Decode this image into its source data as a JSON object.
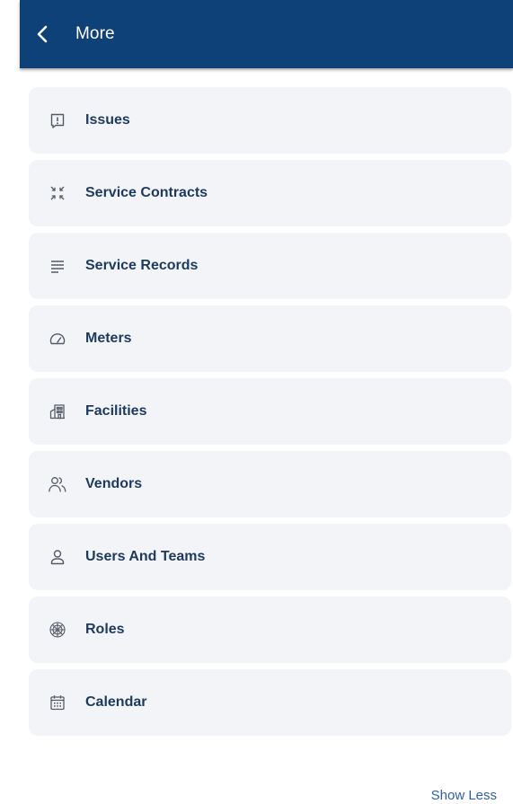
{
  "header": {
    "title": "More",
    "back_icon": "chevron-left-icon",
    "background_color": "#0d4178"
  },
  "menu": {
    "items": [
      {
        "label": "Issues",
        "icon": "issue-icon"
      },
      {
        "label": "Service Contracts",
        "icon": "collapse-arrows-icon"
      },
      {
        "label": "Service Records",
        "icon": "lines-icon"
      },
      {
        "label": "Meters",
        "icon": "gauge-icon"
      },
      {
        "label": "Facilities",
        "icon": "building-icon"
      },
      {
        "label": "Vendors",
        "icon": "users-group-icon"
      },
      {
        "label": "Users And Teams",
        "icon": "user-icon"
      },
      {
        "label": "Roles",
        "icon": "roles-icon"
      },
      {
        "label": "Calendar",
        "icon": "calendar-icon"
      }
    ]
  },
  "footer": {
    "show_less_label": "Show Less",
    "link_color": "#2f5ea6"
  }
}
